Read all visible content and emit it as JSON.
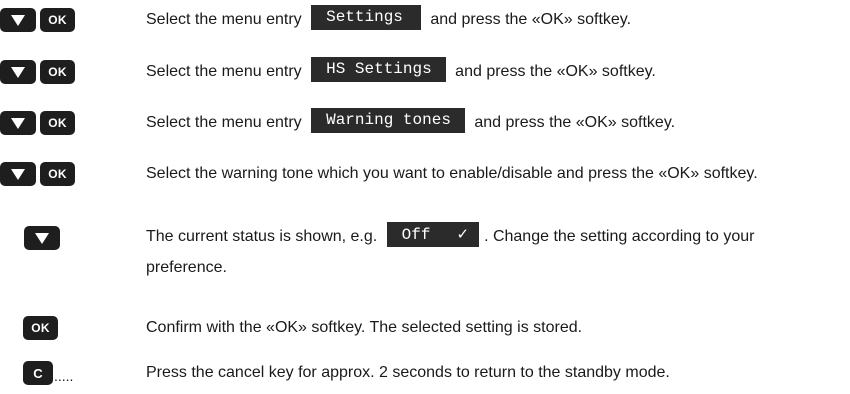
{
  "steps": [
    {
      "keys": [
        "down",
        "ok"
      ],
      "text_before": "Select the menu entry",
      "display": "Settings",
      "text_after": "and press the «OK» softkey."
    },
    {
      "keys": [
        "down",
        "ok"
      ],
      "text_before": "Select the menu entry",
      "display": "HS Settings",
      "text_after": "and press the «OK» softkey."
    },
    {
      "keys": [
        "down",
        "ok"
      ],
      "text_before": "Select the menu entry",
      "display": "Warning tones",
      "text_after": "and press the «OK» softkey."
    },
    {
      "keys": [
        "down",
        "ok"
      ],
      "text": "Select the warning tone which you want to enable/disable and press the «OK» softkey."
    },
    {
      "keys": [
        "down"
      ],
      "text_before": "The current status is shown, e.g.",
      "display": "Off",
      "display_check": "✓",
      "text_after": ". Change the setting according to your preference."
    },
    {
      "keys": [
        "ok"
      ],
      "text": "Confirm with the «OK» softkey. The selected setting is stored."
    },
    {
      "keys": [
        "c"
      ],
      "key_suffix": ".....",
      "text": "Press the cancel key for approx. 2 seconds to return to the standby mode."
    }
  ],
  "key_labels": {
    "ok": "OK",
    "c": "C"
  },
  "icons": {
    "down": "down-arrow-icon"
  }
}
